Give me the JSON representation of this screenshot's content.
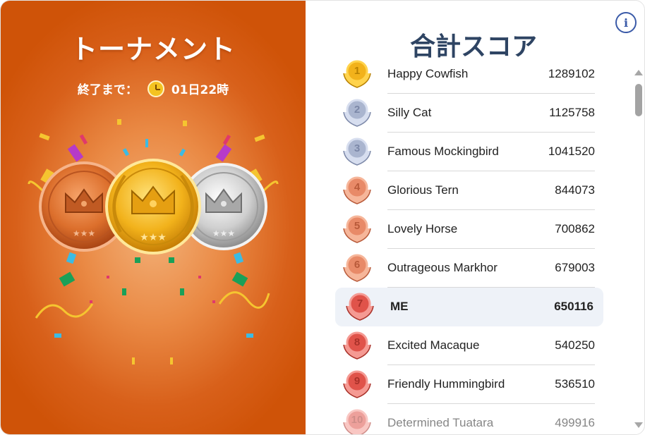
{
  "left_panel": {
    "title": "トーナメント",
    "timer_label": "終了まで：",
    "timer_value": "01日22時",
    "timer_icon": "clock-icon"
  },
  "right_panel": {
    "title": "合計スコア",
    "info_icon": "i",
    "leaderboard": [
      {
        "rank": "1",
        "name": "Happy Cowfish",
        "score": "1289102",
        "tier": "gold"
      },
      {
        "rank": "2",
        "name": "Silly Cat",
        "score": "1125758",
        "tier": "silver"
      },
      {
        "rank": "3",
        "name": "Famous Mockingbird",
        "score": "1041520",
        "tier": "silver"
      },
      {
        "rank": "4",
        "name": "Glorious Tern",
        "score": "844073",
        "tier": "bronze"
      },
      {
        "rank": "5",
        "name": "Lovely Horse",
        "score": "700862",
        "tier": "bronze"
      },
      {
        "rank": "6",
        "name": "Outrageous Markhor",
        "score": "679003",
        "tier": "bronze"
      },
      {
        "rank": "7",
        "name": "ME",
        "score": "650116",
        "tier": "red"
      },
      {
        "rank": "8",
        "name": "Excited Macaque",
        "score": "540250",
        "tier": "red"
      },
      {
        "rank": "9",
        "name": "Friendly Hummingbird",
        "score": "536510",
        "tier": "red"
      },
      {
        "rank": "10",
        "name": "Determined Tuatara",
        "score": "499916",
        "tier": "red"
      }
    ]
  },
  "colors": {
    "panel_orange": "#d8601a",
    "title_navy": "#2e4463",
    "gold": "#f2b21b",
    "silver": "#aab5cf",
    "bronze": "#e88a68",
    "red": "#e0534a",
    "me_highlight": "#eef2f8"
  }
}
